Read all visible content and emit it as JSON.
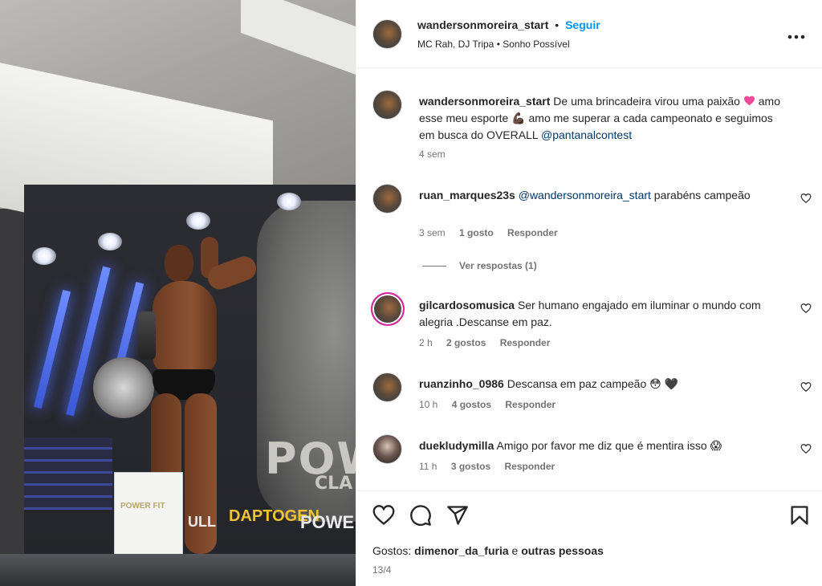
{
  "post": {
    "author": "wandersonmoreira_start",
    "dot": "•",
    "follow_label": "Seguir",
    "audio": "MC Rah, DJ Tripa • Sonho Possível",
    "more_label": "•••"
  },
  "image_text": {
    "backdrop_brand": "POW",
    "backdrop_sub": "CLA",
    "bag_brand": "POWER FIT",
    "sponsor_a": "ULL",
    "sponsor_b": "DAPTOGEN",
    "sponsor_c": "POWE"
  },
  "caption": {
    "username": "wandersonmoreira_start",
    "text_part1": "De uma brincadeira virou uma paixão",
    "text_part2": "amo esse meu esporte 💪🏿 amo me superar a cada campeonato e seguimos em busca do OVERALL",
    "mention": "@pantanalcontest",
    "time": "4 sem"
  },
  "comments": [
    {
      "username": "ruan_marques23s",
      "mention": "@wandersonmoreira_start",
      "text": "parabéns campeão",
      "time": "3 sem",
      "likes": "1 gosto",
      "reply": "Responder",
      "view_replies": "Ver respostas (1)"
    },
    {
      "username": "gilcardosomusica",
      "mention": "",
      "text": "Ser humano engajado em iluminar o mundo com alegria .Descanse em paz.",
      "time": "2 h",
      "likes": "2 gostos",
      "reply": "Responder"
    },
    {
      "username": "ruanzinho_0986",
      "mention": "",
      "text": "Descansa em paz campeão 😳 🖤",
      "time": "10 h",
      "likes": "4 gostos",
      "reply": "Responder"
    },
    {
      "username": "duekludymilla",
      "mention": "",
      "text": "Amigo por favor me diz que é mentira isso 😱",
      "time": "11 h",
      "likes": "3 gostos",
      "reply": "Responder"
    }
  ],
  "footer": {
    "likes_prefix": "Gostos:",
    "liked_by": "dimenor_da_furia",
    "likes_and": "e",
    "likes_others": "outras pessoas",
    "date": "13/4"
  },
  "icons": {
    "like": "heart-outline-icon",
    "comment": "comment-bubble-icon",
    "share": "paper-plane-icon",
    "save": "bookmark-icon",
    "more": "more-dots-icon"
  },
  "colors": {
    "link_blue": "#0095f6",
    "mention_blue": "#00376b",
    "muted": "#737373",
    "text": "#262626",
    "heart_pink": "#ed4996"
  }
}
